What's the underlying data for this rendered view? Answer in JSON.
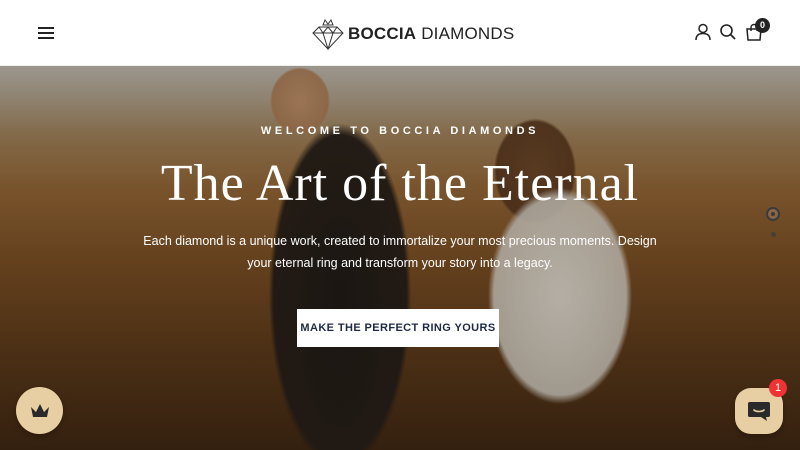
{
  "header": {
    "logo_bold": "BOCCIA",
    "logo_light": " DIAMONDS",
    "cart_count": "0"
  },
  "hero": {
    "eyebrow": "WELCOME TO BOCCIA DIAMONDS",
    "title": "The Art of the Eternal",
    "description": "Each diamond is a unique work, created to immortalize your most precious moments. Design your eternal ring and transform your story into a legacy.",
    "cta_label": "MAKE THE PERFECT RING YOURS"
  },
  "chat": {
    "badge_count": "1"
  },
  "icons": [
    "menu-icon",
    "diamond-logo-icon",
    "account-icon",
    "search-icon",
    "cart-icon",
    "crown-icon",
    "chat-icon"
  ],
  "colors": {
    "accent": "#e8cfa3",
    "cta_text": "#1e2a44",
    "badge": "#e33333"
  }
}
